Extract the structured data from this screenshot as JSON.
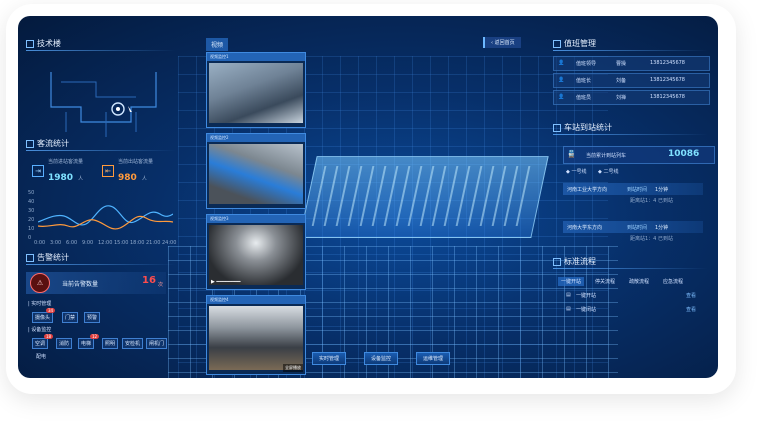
{
  "colors": {
    "accent": "#3f8ae0",
    "warning": "#ff9a3c",
    "danger": "#ff4d4d",
    "count": "#7fe1ff"
  },
  "left": {
    "map": {
      "title": "技术楼"
    },
    "flow": {
      "title": "客流统计",
      "in_label": "当前进站客流量",
      "in_value": "1980",
      "in_unit": "人",
      "out_label": "当前出站客流量",
      "out_value": "980",
      "out_unit": "人",
      "y_ticks": [
        "50",
        "40",
        "30",
        "20",
        "10",
        "0"
      ],
      "x_ticks": [
        "0:00",
        "3:00",
        "6:00",
        "9:00",
        "12:00",
        "15:00",
        "18:00",
        "21:00",
        "24:00"
      ]
    },
    "alarm": {
      "title": "告警统计",
      "current_label": "当前告警数量",
      "current_value": "16",
      "current_unit": "次",
      "section_track": "实时管理",
      "track_tags": [
        "摄像头",
        "门禁",
        "预警"
      ],
      "track_badges": [
        "34"
      ],
      "section_device": "设备监控",
      "device_tags": [
        "空调",
        "消防",
        "电梯",
        "照明",
        "安检机",
        "闸机门"
      ],
      "device_badges": [
        "18",
        "12"
      ],
      "extra": "配电"
    }
  },
  "cameras": {
    "header": "视频",
    "items": [
      {
        "title": "视频监控1"
      },
      {
        "title": "视频监控2"
      },
      {
        "title": "视频监控3"
      },
      {
        "title": "视频监控4"
      }
    ],
    "full_btn": "全屏播放"
  },
  "center": {
    "back_label": "返回首页",
    "bottom_buttons": [
      "实时管理",
      "设备监控",
      "运维管理"
    ]
  },
  "right": {
    "duty": {
      "title": "值班管理",
      "rows": [
        {
          "role": "值班领导",
          "name": "曹操",
          "phone": "13812345678"
        },
        {
          "role": "值班长",
          "name": "刘备",
          "phone": "13812345678"
        },
        {
          "role": "值班员",
          "name": "刘禅",
          "phone": "13812345678"
        }
      ]
    },
    "pass": {
      "title": "车站到站统计",
      "label": "当前累计到站列车",
      "value": "10086",
      "legend": [
        "一号线",
        "二号线"
      ],
      "routes": [
        {
          "name": "河南工业大学方向",
          "tag": "到站时间",
          "time": "1分钟",
          "status": "距离站1：4 已到站"
        },
        {
          "name": "河南大学东方向",
          "tag": "到站时间",
          "time": "1分钟",
          "status": "距离站1：4 已到站"
        }
      ]
    },
    "doc": {
      "title": "标准流程",
      "tabs": [
        "一键开站",
        "停关流程",
        "疏散流程",
        "应急流程"
      ],
      "rows": [
        {
          "name": "一键开站",
          "action": "查看"
        },
        {
          "name": "一键闭站",
          "action": "查看"
        }
      ]
    }
  }
}
